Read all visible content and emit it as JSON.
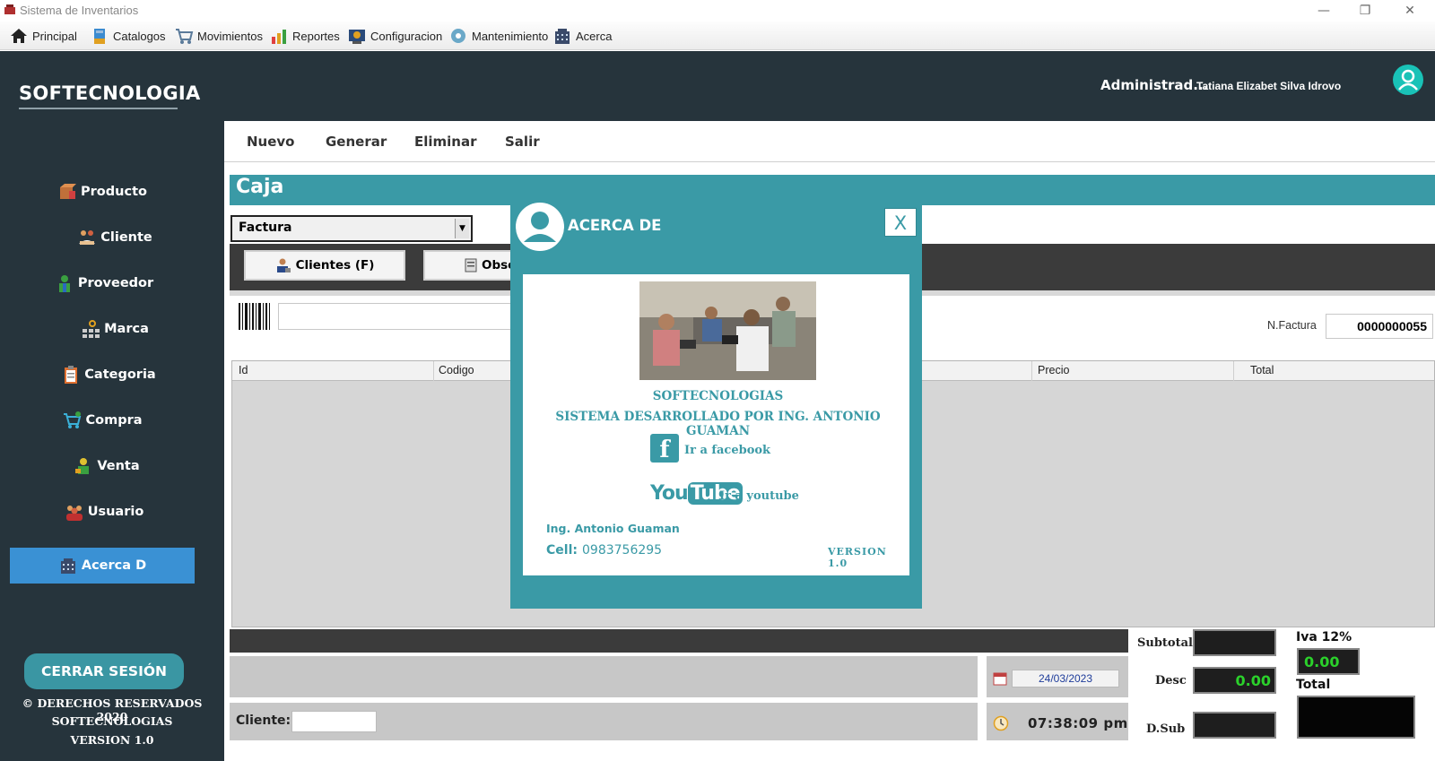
{
  "window": {
    "title": "Sistema de Inventarios",
    "controls": [
      "—",
      "❐",
      "✕"
    ]
  },
  "menu": [
    {
      "label": "Principal",
      "icon": "home-icon"
    },
    {
      "label": "Catalogos",
      "icon": "catalog-icon"
    },
    {
      "label": "Movimientos",
      "icon": "cart-icon"
    },
    {
      "label": "Reportes",
      "icon": "report-chart-icon"
    },
    {
      "label": "Configuracion",
      "icon": "config-icon"
    },
    {
      "label": "Mantenimiento",
      "icon": "maintenance-icon"
    },
    {
      "label": "Acerca",
      "icon": "building-icon"
    }
  ],
  "sidebar": {
    "brand": "SOFTECNOLOGIA",
    "items": [
      {
        "label": "Producto",
        "icon": "box-icon"
      },
      {
        "label": "Cliente",
        "icon": "client-icon"
      },
      {
        "label": "Proveedor",
        "icon": "supplier-icon"
      },
      {
        "label": "Marca",
        "icon": "brand-icon"
      },
      {
        "label": "Categoria",
        "icon": "clipboard-icon"
      },
      {
        "label": "Compra",
        "icon": "cart-icon"
      },
      {
        "label": "Venta",
        "icon": "sale-icon"
      },
      {
        "label": "Usuario",
        "icon": "users-icon"
      },
      {
        "label": "Acerca D",
        "icon": "building-icon",
        "active": true
      }
    ],
    "logout": "CERRAR SESIÓN",
    "footer": [
      "© DERECHOS RESERVADOS 2020",
      "SOFTECNOLOGIAS",
      "VERSION 1.0"
    ]
  },
  "header": {
    "role": "Administrad...",
    "user": "Tatiana Elizabet Silva Idrovo",
    "accent": "#19c2b7"
  },
  "actions": [
    "Nuevo",
    "Generar",
    "Eliminar",
    "Salir"
  ],
  "caja": {
    "title": "Caja",
    "doc_type": "Factura",
    "clientes_btn": "Clientes (F)",
    "obs_btn": "Obse",
    "nfactura_label": "N.Factura",
    "nfactura": "0000000055"
  },
  "table": {
    "columns": [
      "Id",
      "Codigo",
      "Precio",
      "Total"
    ]
  },
  "footer_panel": {
    "cliente_label": "Cliente:",
    "date": "24/03/2023",
    "time": "07:38:09 pm",
    "subtotal_label": "Subtotal",
    "desc_label": "Desc",
    "desc_value": "0.00",
    "dsub_label": "D.Sub",
    "iva_label": "Iva 12%",
    "iva_value": "0.00",
    "total_label": "Total"
  },
  "about_modal": {
    "title": "ACERCA DE",
    "close": "X",
    "line1": "SOFTECNOLOGIAS",
    "line2": "SISTEMA DESARROLLADO POR  ING. ANTONIO GUAMAN",
    "facebook": "Ir a facebook",
    "youtube_you": "You",
    "youtube_tube": "Tube",
    "youtube": "Ir a youtube",
    "author": "Ing. Antonio Guaman",
    "cell_label": "Cell:",
    "cell": "0983756295",
    "version": "VERSION 1.0",
    "accent": "#3a9aa6"
  }
}
